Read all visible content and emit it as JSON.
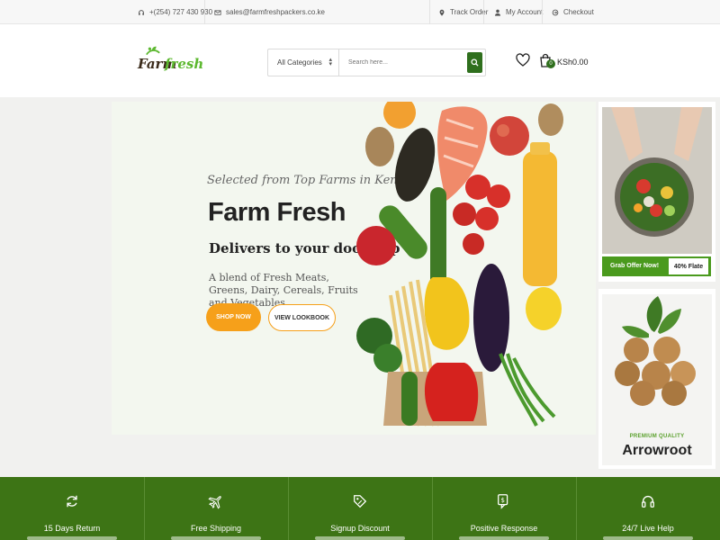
{
  "topbar": {
    "phone": "+(254) 727 430 930",
    "email": "sales@farmfreshpackers.co.ke",
    "track_order": "Track Order",
    "my_account": "My Account",
    "checkout": "Checkout"
  },
  "header": {
    "logo_word1": "Farm",
    "logo_word2": "fresh",
    "category_select": "All Categories",
    "search_placeholder": "Search here...",
    "cart_count": "0",
    "cart_total": "KSh0.00"
  },
  "hero": {
    "tagline": "Selected from Top Farms in Kenya",
    "title": "Farm Fresh",
    "subtitle": "Delivers to your doorstep",
    "description": "A blend of Fresh Meats, Greens, Dairy, Cereals, Fruits and Vegetables",
    "shop_now": "SHOP NOW",
    "view_lookbook": "VIEW LOOKBOOK"
  },
  "side_banners": {
    "offer_text": "Grab Offer Now!",
    "offer_value": "40% Flate",
    "premium_label": "PREMIUM QUALITY",
    "product_name": "Arrowroot"
  },
  "features": [
    {
      "label": "15 Days Return",
      "icon": "refresh-icon"
    },
    {
      "label": "Free Shipping",
      "icon": "airplane-icon"
    },
    {
      "label": "Signup Discount",
      "icon": "tag-icon"
    },
    {
      "label": "Positive Response",
      "icon": "chat-dollar-icon"
    },
    {
      "label": "24/7 Live Help",
      "icon": "headset-icon"
    }
  ],
  "colors": {
    "brand_green": "#3d7415",
    "accent_orange": "#f6a01a",
    "offer_green": "#4a9a1d"
  }
}
